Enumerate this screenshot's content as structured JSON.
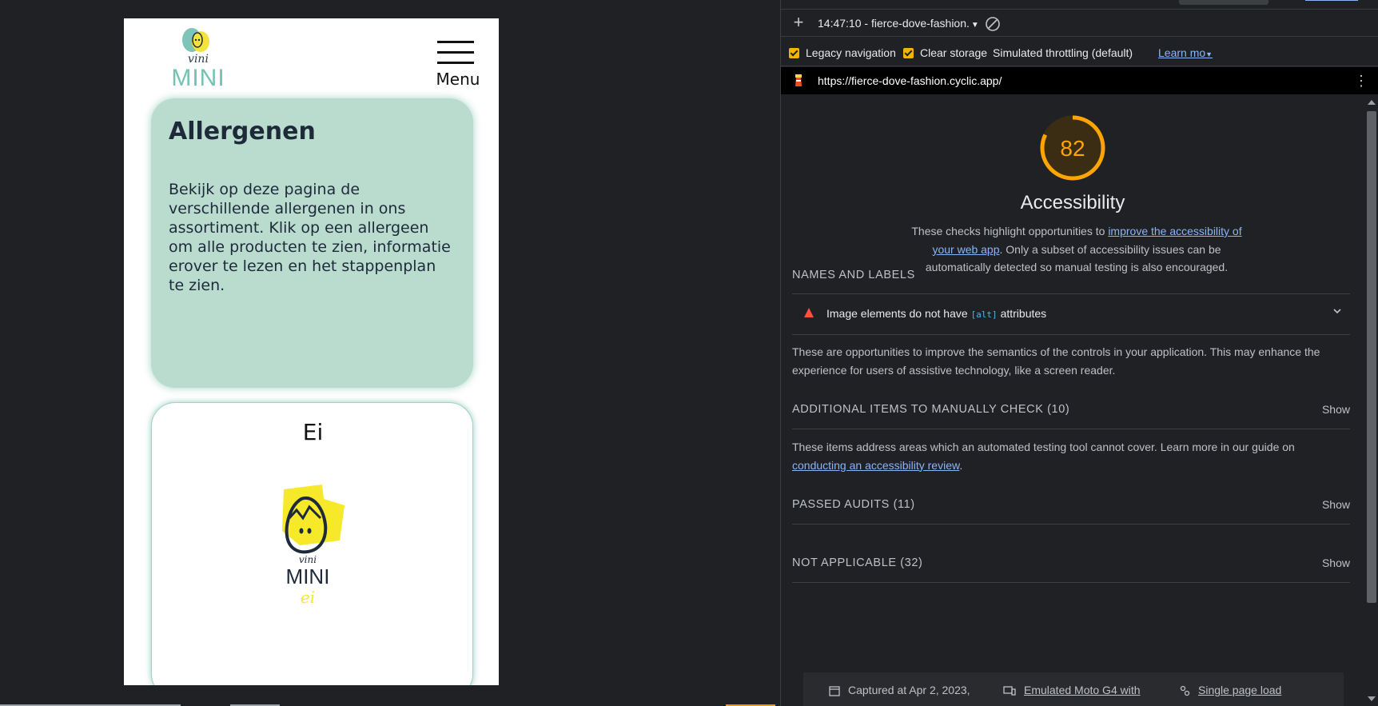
{
  "mobile": {
    "logo": {
      "vini": "vini",
      "mini": "MINI"
    },
    "menu_label": "Menu",
    "intro": {
      "title": "Allergenen",
      "text": "Bekijk op deze pagina de verschillende allergenen in ons assortiment. Klik op een allergeen om alle producten te zien, informatie erover te lezen en het stappenplan te zien."
    },
    "allergen_card": {
      "title": "Ei",
      "image_vini": "vini",
      "image_mini": "MINI",
      "image_ei": "ei"
    }
  },
  "devtools": {
    "toolbar": {
      "report_select": "14:47:10 - fierce-dove-fashion."
    },
    "settings": {
      "legacy_navigation": "Legacy navigation",
      "clear_storage": "Clear storage",
      "throttling": "Simulated throttling (default)",
      "learn_more": "Learn mo"
    },
    "url": "https://fierce-dove-fashion.cyclic.app/",
    "report": {
      "score": "82",
      "score_value": 82,
      "score_color": "#ffa400",
      "category_title": "Accessibility",
      "desc_pre": "These checks highlight opportunities to ",
      "desc_link": "improve the accessibility of your web app",
      "desc_post": ". Only a subset of accessibility issues can be automatically detected so manual testing is also encouraged.",
      "names_labels": {
        "title": "NAMES AND LABELS",
        "audit_pre": "Image elements do not have ",
        "audit_code": "[alt]",
        "audit_post": " attributes",
        "desc": "These are opportunities to improve the semantics of the controls in your application. This may enhance the experience for users of assistive technology, like a screen reader."
      },
      "manual": {
        "title": "ADDITIONAL ITEMS TO MANUALLY CHECK (10)",
        "show": "Show",
        "desc_pre": "These items address areas which an automated testing tool cannot cover. Learn more in our guide on ",
        "desc_link": "conducting an accessibility review",
        "desc_post": "."
      },
      "passed": {
        "title": "PASSED AUDITS (11)",
        "show": "Show"
      },
      "not_applicable": {
        "title": "NOT APPLICABLE (32)",
        "show": "Show"
      },
      "footer": {
        "captured": "Captured at Apr 2, 2023,",
        "emulated": "Emulated Moto G4 with",
        "single": "Single page load"
      }
    }
  }
}
